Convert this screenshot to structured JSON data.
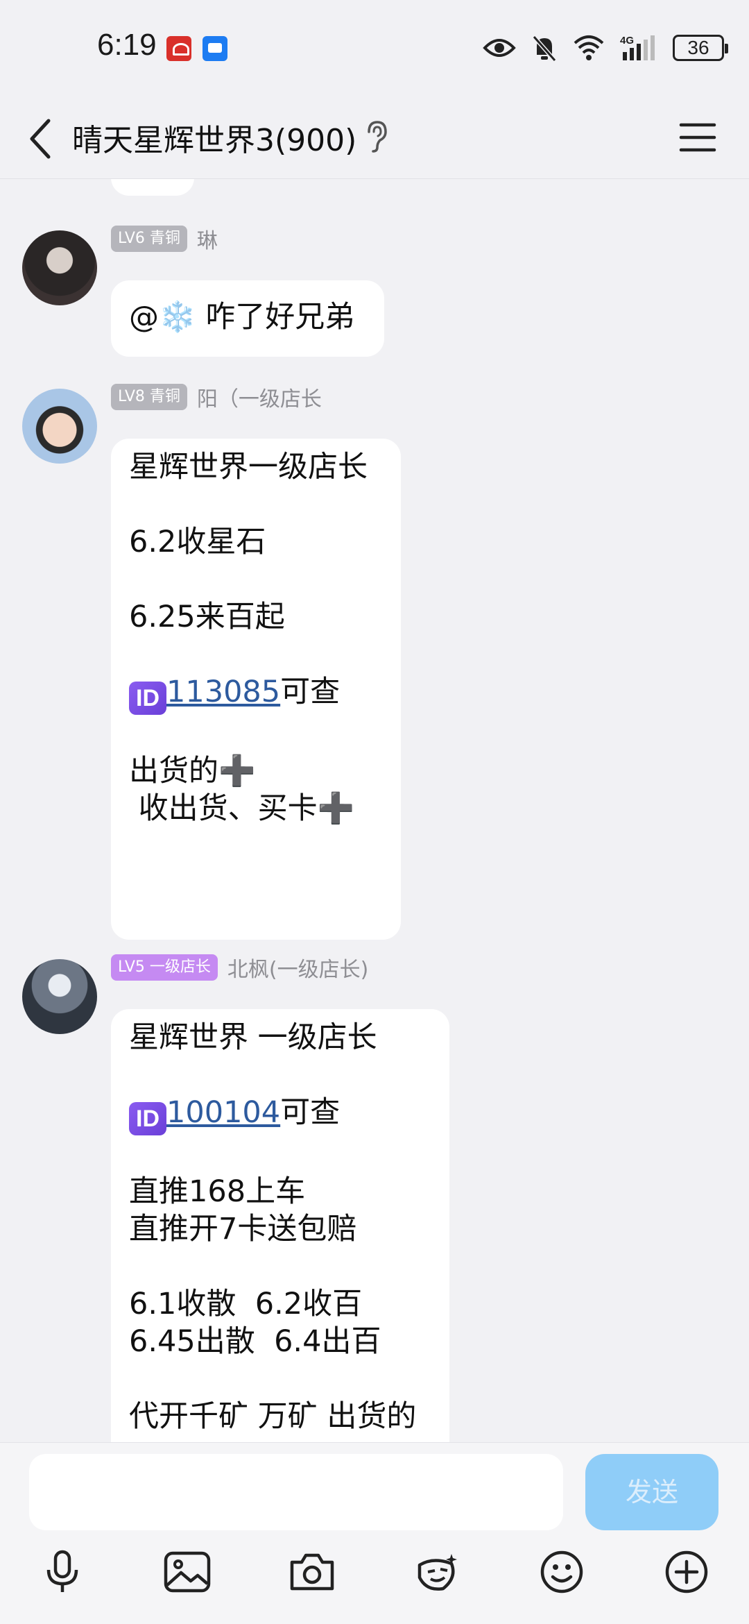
{
  "status_bar": {
    "time": "6:19",
    "battery": "36",
    "icons": [
      "huawei-app-icon",
      "messages-app-icon",
      "eye-icon",
      "mute-bell-icon",
      "wifi-icon",
      "4g-signal-icon",
      "battery-icon"
    ]
  },
  "header": {
    "title": "晴天星辉世界3(900)",
    "icons": [
      "back-icon",
      "ear-icon",
      "menu-icon"
    ]
  },
  "messages": [
    {
      "level": "LV6 青铜",
      "sender": "琳",
      "text": "@❄️ 咋了好兄弟"
    },
    {
      "level": "LV8 青铜",
      "sender": "阳（一级店长",
      "lines": [
        "星辉世界一级店长",
        "6.2收星石",
        "6.25来百起",
        "ID",
        "113085",
        "可查",
        "出货的➕",
        " 收出货、买卡➕"
      ]
    },
    {
      "level": "LV5 一级店长",
      "sender": "北枫(一级店长)",
      "lines": [
        "星辉世界 一级店长",
        "ID",
        "100104",
        "可查",
        "直推168上车",
        "直推开7卡送包赔",
        "6.1收散  6.2收百",
        "6.45出散  6.4出百",
        "代开千矿 万矿 出货的"
      ]
    }
  ],
  "input": {
    "send_label": "发送"
  },
  "toolbar": [
    "microphone-icon",
    "image-icon",
    "camera-icon",
    "sticker-icon",
    "emoji-icon",
    "plus-icon"
  ]
}
